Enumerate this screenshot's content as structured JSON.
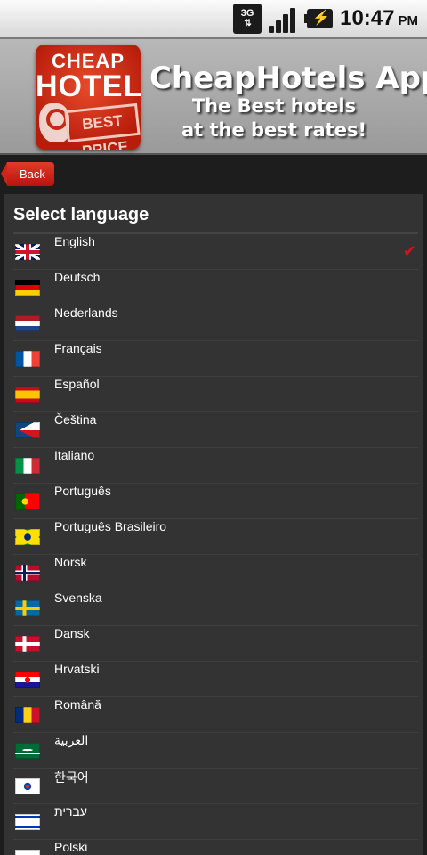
{
  "status_bar": {
    "network": "3G",
    "network_arrows": "⇅",
    "signal_icon": "signal-strength-icon",
    "battery_icon": "battery-charging-icon",
    "time": "10:47",
    "ampm": "PM"
  },
  "banner": {
    "logo_line1": "CHEAP",
    "logo_line2": "HOTELS",
    "logo_stamp": "BEST PRICE",
    "title": "CheapHotels App",
    "subtitle_line1": "The Best hotels",
    "subtitle_line2": "at the best rates!"
  },
  "toolbar": {
    "back_label": "Back"
  },
  "page": {
    "heading": "Select language"
  },
  "languages": [
    {
      "label": "English",
      "flag": "uk-flag-icon",
      "selected": true
    },
    {
      "label": "Deutsch",
      "flag": "germany-flag-icon"
    },
    {
      "label": "Nederlands",
      "flag": "netherlands-flag-icon"
    },
    {
      "label": "Français",
      "flag": "france-flag-icon"
    },
    {
      "label": "Español",
      "flag": "spain-flag-icon"
    },
    {
      "label": "Čeština",
      "flag": "czech-flag-icon"
    },
    {
      "label": "Italiano",
      "flag": "italy-flag-icon"
    },
    {
      "label": "Português",
      "flag": "portugal-flag-icon"
    },
    {
      "label": "Português Brasileiro",
      "flag": "brazil-flag-icon"
    },
    {
      "label": "Norsk",
      "flag": "norway-flag-icon"
    },
    {
      "label": "Svenska",
      "flag": "sweden-flag-icon"
    },
    {
      "label": "Dansk",
      "flag": "denmark-flag-icon"
    },
    {
      "label": "Hrvatski",
      "flag": "croatia-flag-icon"
    },
    {
      "label": "Română",
      "flag": "romania-flag-icon"
    },
    {
      "label": "العربية",
      "flag": "saudi-arabia-flag-icon"
    },
    {
      "label": "한국어",
      "flag": "south-korea-flag-icon"
    },
    {
      "label": "עברית",
      "flag": "israel-flag-icon"
    },
    {
      "label": "Polski",
      "flag": "poland-flag-icon"
    }
  ],
  "colors": {
    "accent": "#c8160f",
    "check": "#d0141a",
    "background": "#1d1d1d",
    "list_background": "#333333"
  }
}
